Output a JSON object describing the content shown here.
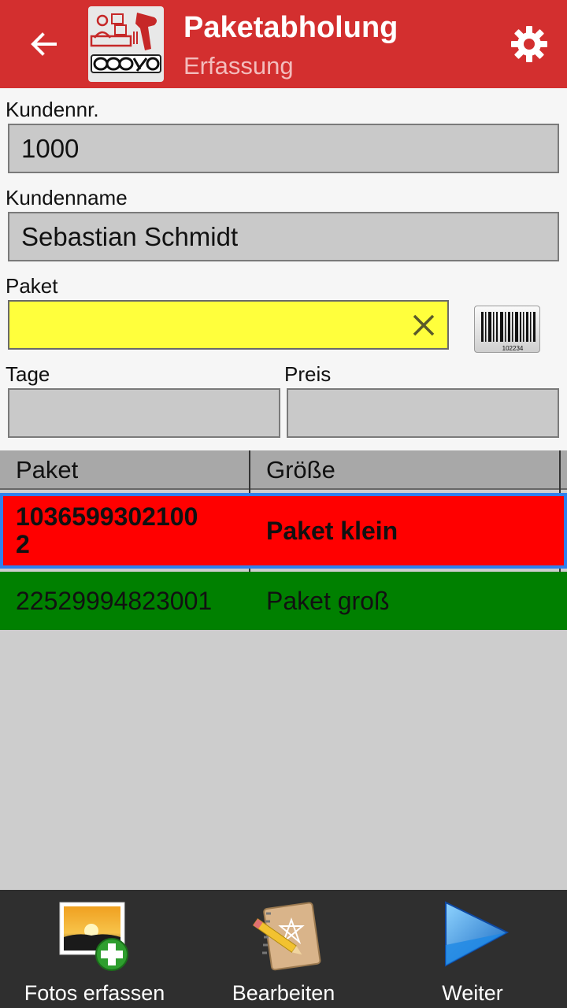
{
  "header": {
    "title": "Paketabholung",
    "subtitle": "Erfassung",
    "logo_text": "cosys",
    "back_icon": "arrow-left-icon",
    "settings_icon": "gear-icon",
    "background": "#d32f2f"
  },
  "form": {
    "kundennr": {
      "label": "Kundennr.",
      "value": "1000"
    },
    "kundenname": {
      "label": "Kundenname",
      "value": "Sebastian Schmidt"
    },
    "paket": {
      "label": "Paket",
      "value": "",
      "clear_icon": "clear-x-icon",
      "scan_icon": "barcode-icon",
      "barcode_text": "102234"
    },
    "tage": {
      "label": "Tage",
      "value": ""
    },
    "preis": {
      "label": "Preis",
      "value": ""
    }
  },
  "table": {
    "columns": [
      "Paket",
      "Größe"
    ],
    "rows": [
      {
        "paket": "1036599302100\n2",
        "groesse": "Paket klein",
        "color": "#ff0000",
        "selected": true
      },
      {
        "paket": "22529994823001",
        "groesse": "Paket groß",
        "color": "#008000",
        "selected": false
      }
    ]
  },
  "bottom_bar": {
    "items": [
      {
        "label": "Fotos erfassen",
        "icon": "photo-add-icon"
      },
      {
        "label": "Bearbeiten",
        "icon": "notebook-pencil-icon"
      },
      {
        "label": "Weiter",
        "icon": "play-forward-icon"
      }
    ]
  }
}
